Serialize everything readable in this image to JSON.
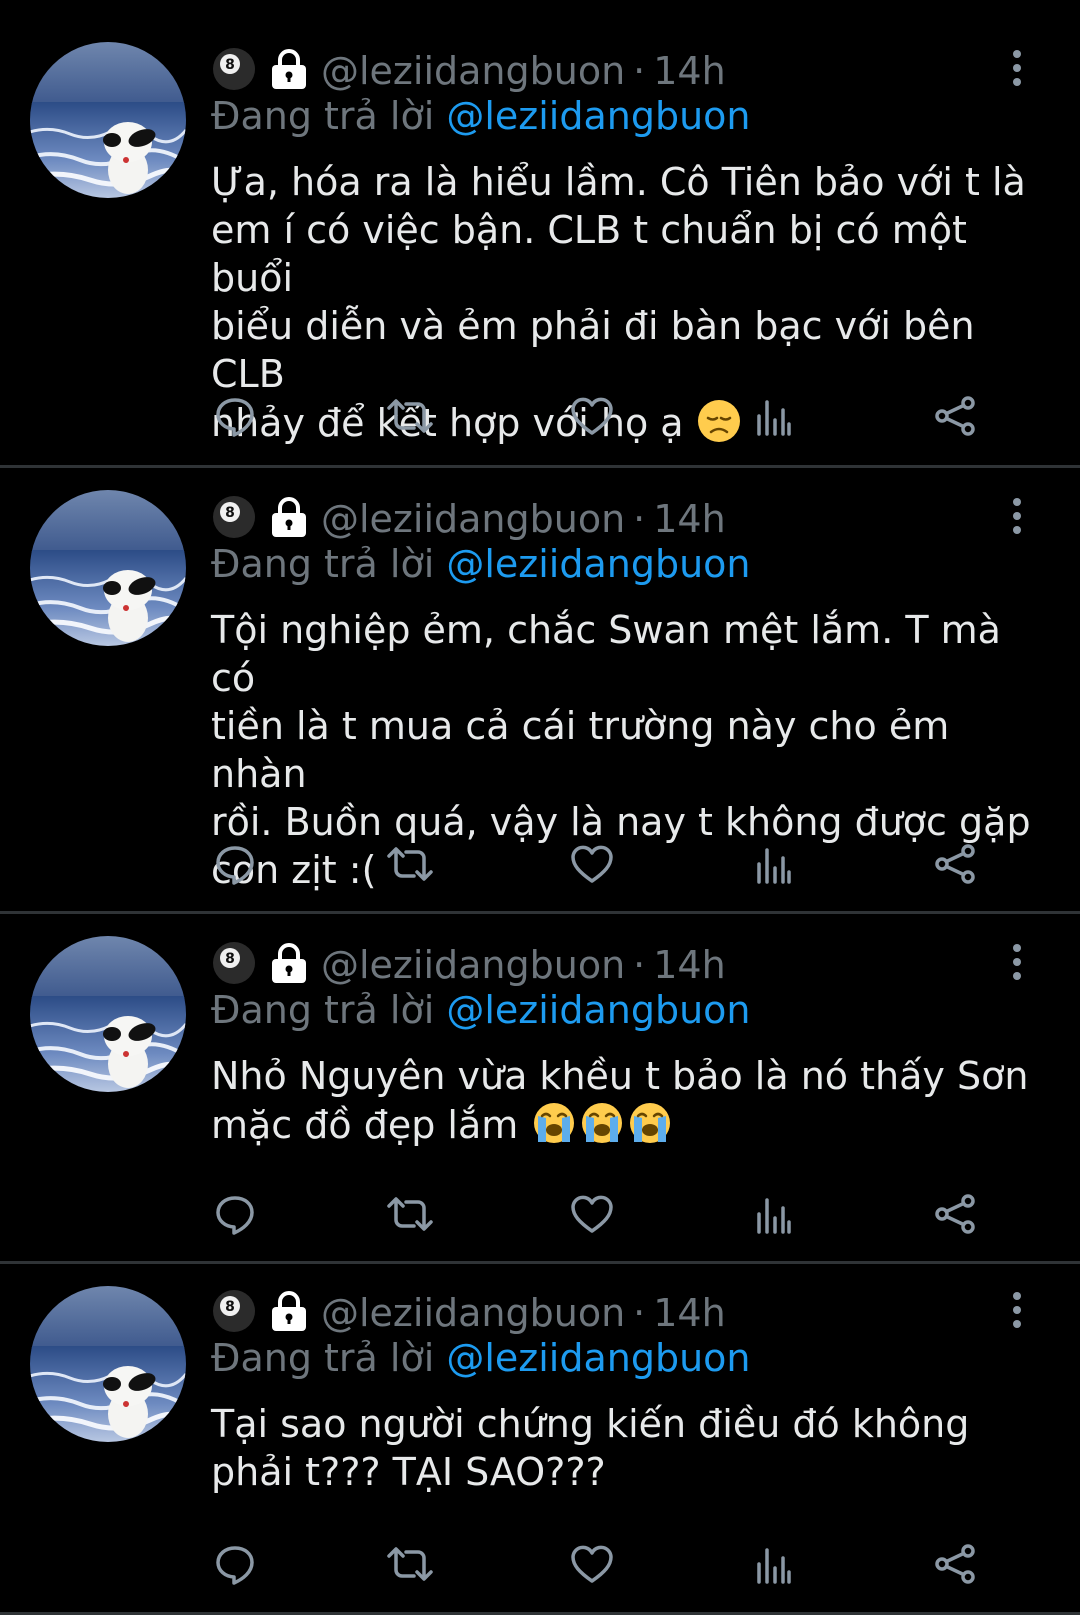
{
  "colors": {
    "background": "#000000",
    "text": "#e7e9ea",
    "secondary": "#6e767d",
    "accent": "#1d9bf0",
    "divider": "#2f3336"
  },
  "tweets": [
    {
      "handle": "@leziidangbuon",
      "separator": "·",
      "time": "14h",
      "reply_prefix": "Đang trả lời",
      "reply_to": "@leziidangbuon",
      "text": "Ựa, hóa ra là hiểu lầm. Cô Tiên bảo với t là\nem í có việc bận. CLB t chuẩn bị có một buổi\nbiểu diễn và ẻm phải đi bàn bạc với bên CLB\nnhảy để kết hợp với họ ạ",
      "emoji": [
        "disappointed-face"
      ]
    },
    {
      "handle": "@leziidangbuon",
      "separator": "·",
      "time": "14h",
      "reply_prefix": "Đang trả lời",
      "reply_to": "@leziidangbuon",
      "text": "Tội nghiệp ẻm, chắc Swan mệt lắm. T mà có\ntiền là t mua cả cái trường này cho ẻm nhàn\nrồi. Buồn quá, vậy là nay t không được gặp\ncon zịt :(",
      "emoji": []
    },
    {
      "handle": "@leziidangbuon",
      "separator": "·",
      "time": "14h",
      "reply_prefix": "Đang trả lời",
      "reply_to": "@leziidangbuon",
      "text": "Nhỏ Nguyên vừa khều t bảo là nó thấy Sơn\nmặc đồ đẹp lắm",
      "emoji": [
        "loudly-crying-face",
        "loudly-crying-face",
        "loudly-crying-face"
      ]
    },
    {
      "handle": "@leziidangbuon",
      "separator": "·",
      "time": "14h",
      "reply_prefix": "Đang trả lời",
      "reply_to": "@leziidangbuon",
      "text": "Tại sao người chứng kiến điều đó không\nphải t??? TẠI SAO???",
      "emoji": []
    }
  ],
  "icons": {
    "badge1": "8-ball-icon",
    "badge2": "lock-icon",
    "actions": [
      "reply-icon",
      "retweet-icon",
      "like-icon",
      "analytics-icon",
      "share-icon"
    ]
  }
}
